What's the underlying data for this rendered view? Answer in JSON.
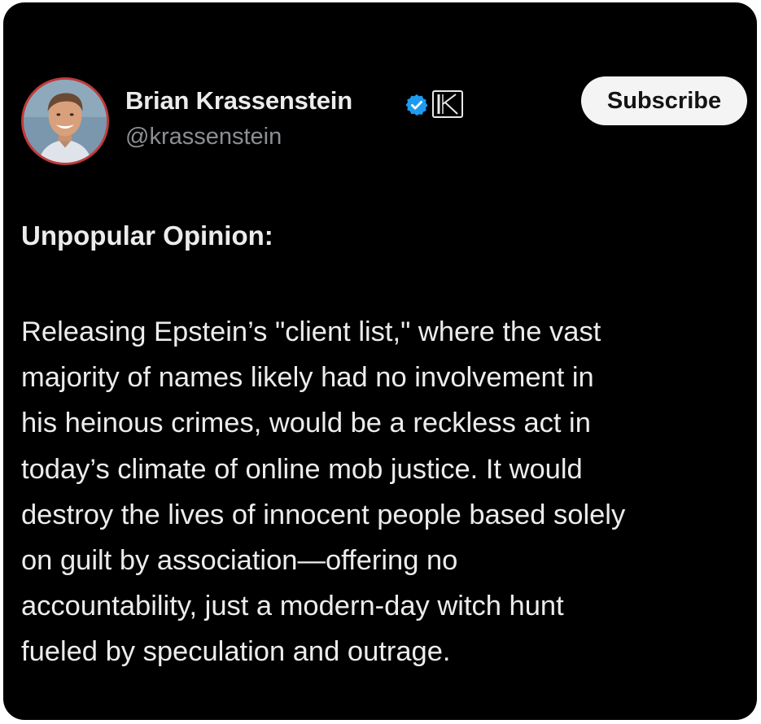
{
  "post": {
    "author": {
      "name": "Brian Krassenstein",
      "handle": "@krassenstein",
      "verified_icon": "verified-badge-icon",
      "affiliate_icon": "affiliate-k-badge-icon"
    },
    "subscribe_label": "Subscribe",
    "heading": "Unpopular Opinion:",
    "body_lines": [
      "Releasing Epstein’s \"client list,\" where the vast",
      "majority of names likely had no involvement in",
      "his heinous crimes, would be a reckless act in",
      "today’s climate of online mob justice. It would",
      "destroy the lives of innocent people based solely",
      "on guilt by association—offering no",
      "accountability, just a modern-day witch hunt",
      "fueled by speculation and outrage."
    ]
  },
  "colors": {
    "background": "#000000",
    "text": "#ececec",
    "handle": "#8b8f93",
    "verified_blue": "#1d9bf0",
    "avatar_ring": "#c23a3a",
    "button_bg": "#f4f4f4"
  }
}
